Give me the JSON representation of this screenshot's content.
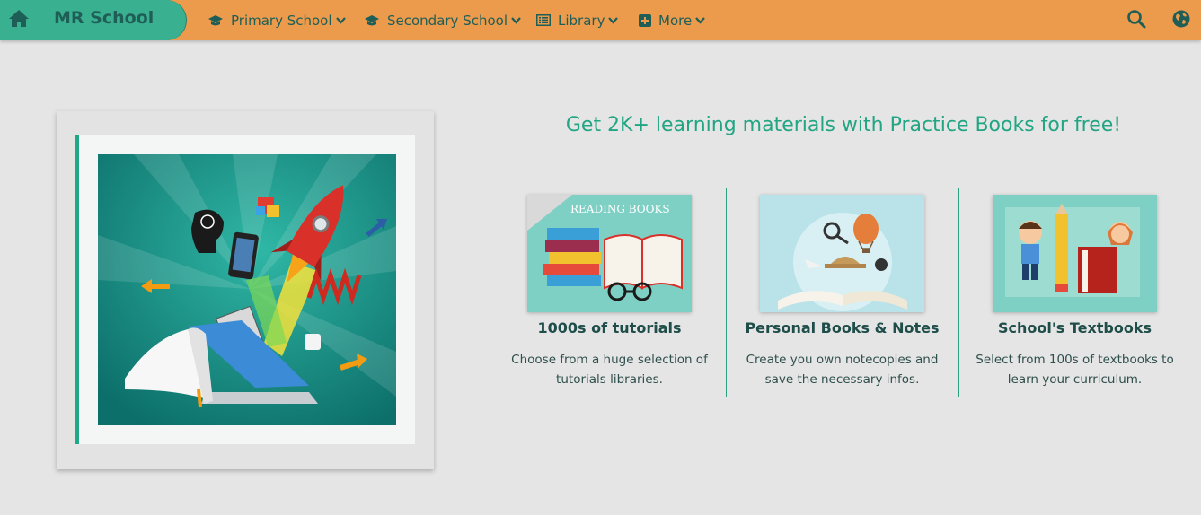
{
  "navbar": {
    "brand": "MR School",
    "items": [
      {
        "label": "Primary School",
        "icon": "graduation-cap-icon"
      },
      {
        "label": "Secondary School",
        "icon": "graduation-cap-icon"
      },
      {
        "label": "Library",
        "icon": "list-icon"
      },
      {
        "label": "More",
        "icon": "plus-square-icon"
      }
    ],
    "right_icons": [
      "search-icon",
      "globe-icon"
    ]
  },
  "main": {
    "headline": "Get 2K+ learning materials with Practice Books for free!",
    "features": [
      {
        "title": "1000s of tutorials",
        "description": "Choose from a huge selection of tutorials libraries.",
        "image_text": "READING BOOKS"
      },
      {
        "title": "Personal Books & Notes",
        "description": "Create you own notecopies and save the necessary infos."
      },
      {
        "title": "School's Textbooks",
        "description": "Select from 100s of textbooks to learn your curriculum."
      }
    ]
  },
  "colors": {
    "navbar": "#ec9b4d",
    "brand": "#39b08f",
    "accent": "#21a583",
    "background": "#e5e5e5"
  }
}
